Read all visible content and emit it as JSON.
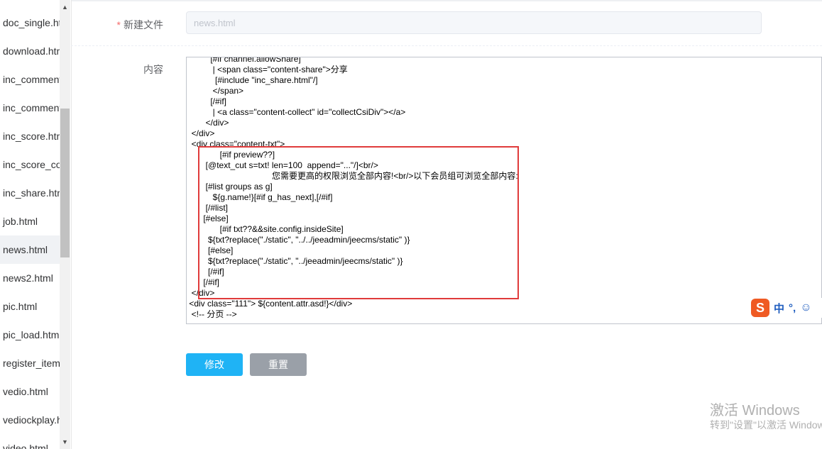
{
  "sidebar": {
    "files": [
      "doc_single.html",
      "download.html",
      "inc_comment.html",
      "inc_comment_list.html",
      "inc_score.html",
      "inc_score_content.html",
      "inc_share.html",
      "job.html",
      "news.html",
      "news2.html",
      "pic.html",
      "pic_load.html",
      "register_item.html",
      "vedio.html",
      "vediockplay.html",
      "video.html"
    ],
    "active_file": "news.html"
  },
  "form": {
    "filename_label": "新建文件",
    "filename_value": "news.html",
    "content_label": "内容",
    "content_code": "          [#if channel.allowShare]\n           | <span class=\"content-share\">分享\n            [#include \"inc_share.html\"/]\n           </span>\n          [/#if]\n           | <a class=\"content-collect\" id=\"collectCsiDiv\"></a>\n        </div>\n  </div>\n  <div class=\"content-txt\">\n              [#if preview??]\n        [@text_cut s=txt! len=100  append=\"...\"/]<br/>\n                                    您需要更高的权限浏览全部内容!<br/>以下会员组可浏览全部内容:\n        [#list groups as g]\n           ${g.name!}[#if g_has_next],[/#if]\n        [/#list]\n       [#else]\n              [#if txt??&&site.config.insideSite]\n         ${txt?replace(\"./static\", \"../../jeeadmin/jeecms/static\" )}\n         [#else]\n         ${txt?replace(\"./static\", \"../jeeadmin/jeecms/static\" )}\n         [/#if]\n       [/#if]\n  </div>\n <div class=\"111\"> ${content.attr.asd!}</div>\n  <!-- 分页 -->"
  },
  "buttons": {
    "submit": "修改",
    "reset": "重置"
  },
  "ime": {
    "logo": "S",
    "mode": "中",
    "punct": "°,",
    "emoji": "☺"
  },
  "watermark": {
    "title": "激活 Windows",
    "subtitle": "转到\"设置\"以激活 Windows。"
  },
  "colors": {
    "primary_button": "#1fb3f5",
    "secondary_button": "#9aa0a8",
    "highlight_border": "#e03b3b",
    "required_star": "#f56c6c"
  }
}
